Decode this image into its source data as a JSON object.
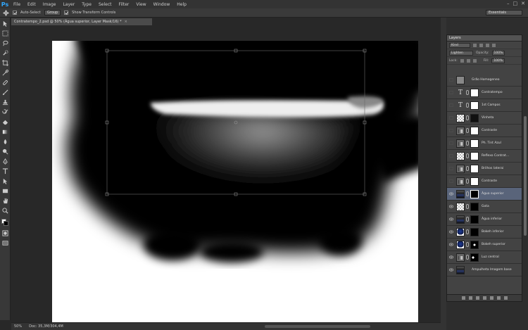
{
  "app": {
    "logo": "Ps"
  },
  "menu": [
    "File",
    "Edit",
    "Image",
    "Layer",
    "Type",
    "Select",
    "Filter",
    "View",
    "Window",
    "Help"
  ],
  "window_controls": [
    "–",
    "□",
    "✕"
  ],
  "options_bar": {
    "auto_select_label": "Auto-Select",
    "group_value": "Group",
    "transform_label": "Show Transform Controls",
    "workspace": "Essentials"
  },
  "document_tab": {
    "title": "Contratempo_2.psd @ 50% (Água superior, Layer Mask/16) *",
    "close": "×"
  },
  "status": {
    "zoom": "50%",
    "doc": "Doc: 35,3M/304,4M"
  },
  "layers_panel": {
    "title": "Layers",
    "kind_filter": "Kind",
    "blend_mode": "Lighten",
    "opacity_label": "Opacity:",
    "opacity": "100%",
    "lock_label": "Lock:",
    "fill_label": "Fill:",
    "fill": "100%",
    "layers": [
      {
        "name": "Grão Homogeneo",
        "thumb": "gray",
        "mask": "none",
        "chain": false,
        "visible": false,
        "selected": false
      },
      {
        "name": "Contratempo",
        "thumb": "textT",
        "mask": "white",
        "chain": true,
        "visible": false,
        "selected": false
      },
      {
        "name": "1st Campos",
        "thumb": "textT",
        "mask": "white",
        "chain": true,
        "visible": false,
        "selected": false
      },
      {
        "name": "Vinheta",
        "thumb": "checker",
        "mask": "dark",
        "chain": true,
        "visible": false,
        "selected": false
      },
      {
        "name": "Contraste",
        "thumb": "adj",
        "mask": "white",
        "chain": true,
        "visible": false,
        "selected": false
      },
      {
        "name": "Ph. Tint Azul",
        "thumb": "adj",
        "mask": "white",
        "chain": true,
        "visible": false,
        "selected": false
      },
      {
        "name": "Reflexo Contrat...",
        "thumb": "checker",
        "mask": "white",
        "chain": true,
        "visible": false,
        "selected": false
      },
      {
        "name": "Brilhos laterai",
        "thumb": "adj",
        "mask": "white",
        "chain": true,
        "visible": false,
        "selected": false
      },
      {
        "name": "Contraste",
        "thumb": "adj",
        "mask": "white",
        "chain": true,
        "visible": false,
        "selected": false
      },
      {
        "name": "Água superior",
        "thumb": "photo",
        "mask": "sel-mask",
        "chain": true,
        "visible": true,
        "selected": true
      },
      {
        "name": "Gota",
        "thumb": "checker",
        "mask": "black",
        "chain": true,
        "visible": true,
        "selected": false
      },
      {
        "name": "Água inferior",
        "thumb": "photo",
        "mask": "black",
        "chain": true,
        "visible": true,
        "selected": false
      },
      {
        "name": "Bokeh inferior",
        "thumb": "bokeh",
        "mask": "black",
        "chain": true,
        "visible": true,
        "selected": false
      },
      {
        "name": "Bokeh superior",
        "thumb": "bokeh",
        "mask": "spot",
        "chain": true,
        "visible": true,
        "selected": false
      },
      {
        "name": "Luz central",
        "thumb": "adj",
        "mask": "spot2",
        "chain": true,
        "visible": true,
        "selected": false
      },
      {
        "name": "Ampulheta Imagem base",
        "thumb": "photo",
        "mask": "none",
        "chain": false,
        "visible": true,
        "selected": false
      }
    ]
  }
}
